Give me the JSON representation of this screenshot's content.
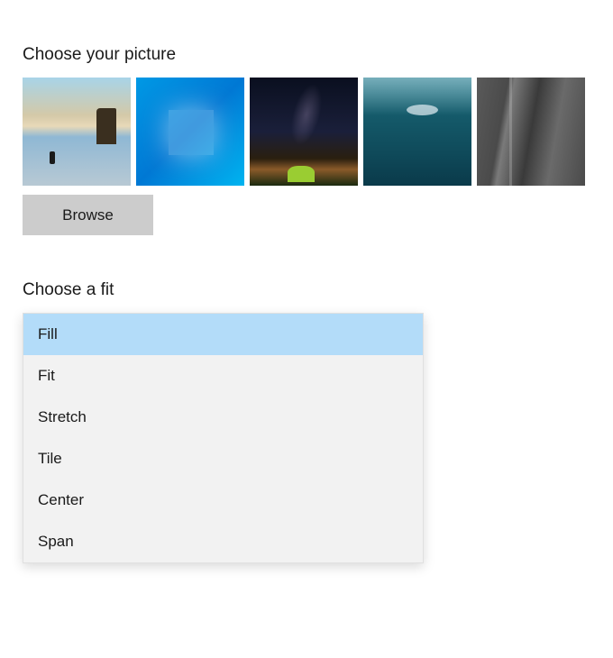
{
  "picture": {
    "title": "Choose your picture",
    "thumbnails": [
      {
        "name": "beach-sunset"
      },
      {
        "name": "windows-blue"
      },
      {
        "name": "night-sky"
      },
      {
        "name": "underwater"
      },
      {
        "name": "rock-wall"
      }
    ],
    "browse_button": "Browse"
  },
  "fit": {
    "title": "Choose a fit",
    "options": [
      {
        "label": "Fill",
        "selected": true
      },
      {
        "label": "Fit",
        "selected": false
      },
      {
        "label": "Stretch",
        "selected": false
      },
      {
        "label": "Tile",
        "selected": false
      },
      {
        "label": "Center",
        "selected": false
      },
      {
        "label": "Span",
        "selected": false
      }
    ]
  }
}
